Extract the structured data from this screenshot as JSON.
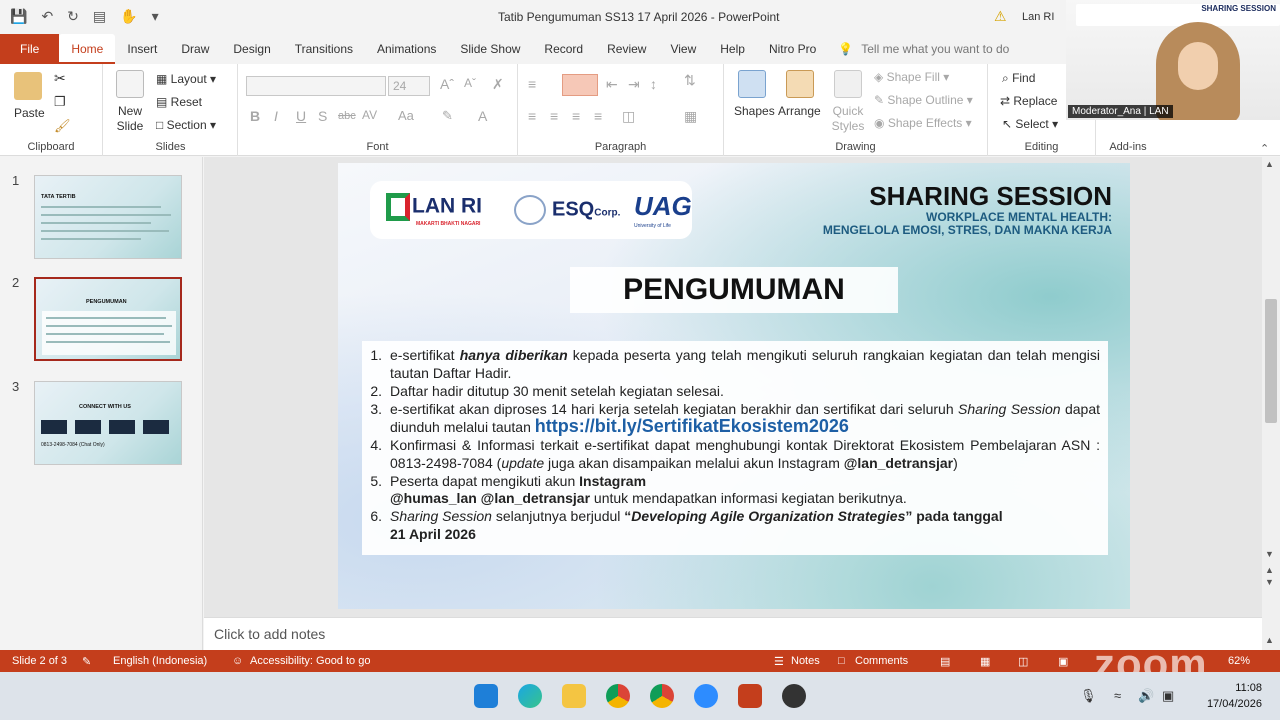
{
  "window": {
    "title": "Tatib Pengumuman SS13 17 April 2026  -  PowerPoint",
    "user": "Lan RI"
  },
  "tabs": [
    "File",
    "Home",
    "Insert",
    "Draw",
    "Design",
    "Transitions",
    "Animations",
    "Slide Show",
    "Record",
    "Review",
    "View",
    "Help",
    "Nitro Pro"
  ],
  "tellme": "Tell me what you want to do",
  "ribbon": {
    "clipboard": {
      "label": "Clipboard",
      "paste": "Paste"
    },
    "slides": {
      "label": "Slides",
      "new_slide": "New Slide",
      "layout": "Layout",
      "reset": "Reset",
      "section": "Section"
    },
    "font": {
      "label": "Font",
      "size": "24"
    },
    "paragraph": {
      "label": "Paragraph"
    },
    "drawing": {
      "label": "Drawing",
      "shapes": "Shapes",
      "arrange": "Arrange",
      "quick_styles": "Quick Styles",
      "fill": "Shape Fill",
      "outline": "Shape Outline",
      "effects": "Shape Effects"
    },
    "editing": {
      "label": "Editing",
      "find": "Find",
      "replace": "Replace",
      "select": "Select"
    },
    "addins": {
      "label": "Add-ins"
    }
  },
  "webcam": {
    "name": "Moderator_Ana | LAN",
    "header": "SHARING SESSION"
  },
  "thumbnails": [
    {
      "num": "1",
      "title": "TATA TERTIB"
    },
    {
      "num": "2",
      "title": "PENGUMUMAN"
    },
    {
      "num": "3",
      "title": "CONNECT WITH US",
      "phone": "0813-2498-7084 (Chat Only)"
    }
  ],
  "slide": {
    "logo_lan": "LAN RI",
    "logo_lan_sub": "MAKARTI BHAKTI NAGARI",
    "logo_esq": "ESQ",
    "logo_esq_suffix": "Corp.",
    "logo_uag": "UAG",
    "logo_uag_sub": "University of Life",
    "title": "SHARING SESSION",
    "subtitle1": "WORKPLACE MENTAL HEALTH:",
    "subtitle2": "MENGELOLA EMOSI, STRES, DAN MAKNA KERJA",
    "heading": "PENGUMUMAN",
    "items": [
      {
        "num": "1.",
        "a": "e-sertifikat ",
        "b": "hanya diberikan",
        "c": " kepada peserta yang telah mengikuti seluruh rangkaian kegiatan dan telah mengisi tautan Daftar Hadir."
      },
      {
        "num": "2.",
        "text": "Daftar hadir ditutup 30 menit setelah kegiatan selesai."
      },
      {
        "num": "3.",
        "a": "e-sertifikat akan diproses 14 hari kerja setelah kegiatan berakhir dan sertifikat dari seluruh ",
        "b": "Sharing Session",
        "c": " dapat diunduh melalui tautan ",
        "link": "https://bit.ly/SertifikatEkosistem2026"
      },
      {
        "num": "4.",
        "a": "Konfirmasi & Informasi terkait e-sertifikat dapat menghubungi kontak Direktorat Ekosistem Pembelajaran ASN : 0813-2498-7084 (",
        "b": "update",
        "c": " juga akan disampaikan melalui akun Instagram ",
        "d": "@lan_detransjar",
        "e": ")"
      },
      {
        "num": "5.",
        "a": "Peserta dapat mengikuti akun ",
        "b": "Instagram",
        "c": "@humas_lan @lan_detransjar",
        "d": " untuk mendapatkan informasi kegiatan berikutnya."
      },
      {
        "num": "6.",
        "a": "Sharing Session",
        "b": " selanjutnya berjudul ",
        "c": "“",
        "d": "Developing Agile Organization Strategies",
        "e": "” pada tanggal",
        "f": "21 April 2026"
      }
    ]
  },
  "notes": "Click to add notes",
  "status": {
    "slide": "Slide 2 of 3",
    "language": "English (Indonesia)",
    "accessibility": "Accessibility: Good to go",
    "notes": "Notes",
    "comments": "Comments",
    "zoom": "62%"
  },
  "watermark": "zoom",
  "clock": {
    "time": "11:08",
    "date": "17/04/2026"
  }
}
